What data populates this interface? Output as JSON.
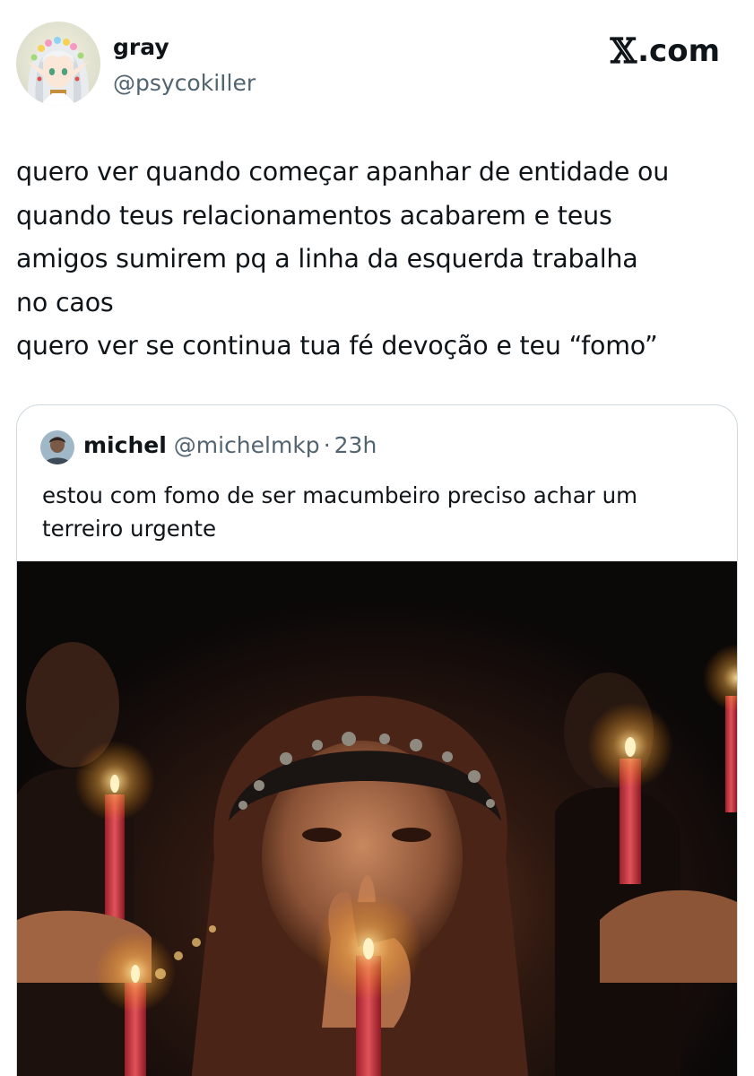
{
  "brand": {
    "logo_glyph": "𝕏",
    "logo_text": ".com"
  },
  "author": {
    "name": "gray",
    "handle": "@psycokiIler"
  },
  "tweet": {
    "lines": [
      "quero ver quando começar apanhar de entidade ou",
      "quando teus relacionamentos acabarem e teus",
      "amigos sumirem pq a linha da esquerda trabalha",
      "no caos",
      "quero ver se continua tua fé devoção e teu “fomo”"
    ]
  },
  "quote": {
    "name": "michel",
    "handle": "@michelmkp",
    "separator": "·",
    "time": "23h",
    "lines": [
      "estou com fomo de ser macumbeiro preciso achar um",
      "terreiro urgente"
    ]
  },
  "colors": {
    "text_primary": "#0f1419",
    "text_secondary": "#536471",
    "border": "#cfd9de",
    "media_background": "#0b0808",
    "candle": "#c8323a",
    "flame": "#ffd27a"
  }
}
